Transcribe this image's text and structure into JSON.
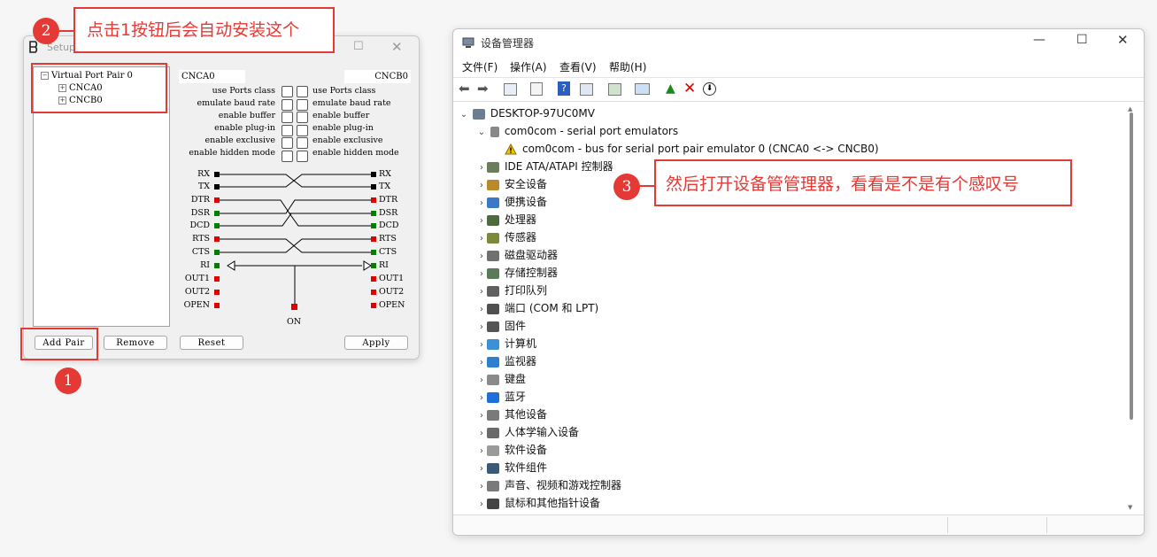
{
  "setup": {
    "title": "Setup for com0com",
    "tree": {
      "root": "Virtual Port Pair 0",
      "children": [
        "CNCA0",
        "CNCB0"
      ]
    },
    "left_port": "CNCA0",
    "right_port": "CNCB0",
    "options": [
      "use Ports class",
      "emulate baud rate",
      "enable buffer",
      "enable plug-in",
      "enable exclusive",
      "enable hidden mode"
    ],
    "left_signals": [
      "RX",
      "TX",
      "DTR",
      "DSR",
      "DCD",
      "RTS",
      "CTS",
      "RI",
      "OUT1",
      "OUT2",
      "OPEN"
    ],
    "right_signals": [
      "RX",
      "TX",
      "DTR",
      "DSR",
      "DCD",
      "RTS",
      "CTS",
      "RI",
      "OUT1",
      "OUT2",
      "OPEN"
    ],
    "on_label": "ON",
    "buttons": {
      "add_pair": "Add Pair",
      "remove": "Remove",
      "reset": "Reset",
      "apply": "Apply"
    },
    "colors": {
      "black": "#000000",
      "red": "#e00000",
      "green": "#008000"
    }
  },
  "annotations": {
    "badge1": "1",
    "badge2": "2",
    "badge3": "3",
    "text2": "点击1按钮后会自动安装这个",
    "text3": "然后打开设备管管理器，看看是不是有个感叹号",
    "color": "#e53935"
  },
  "devmgr": {
    "title": "设备管理器",
    "menu": [
      "文件(F)",
      "操作(A)",
      "查看(V)",
      "帮助(H)"
    ],
    "root": "DESKTOP-97UC0MV",
    "com0com": "com0com - serial port emulators",
    "com0com_child": "com0com - bus for serial port pair emulator 0 (CNCA0 <-> CNCB0)",
    "categories": [
      "IDE ATA/ATAPI 控制器",
      "安全设备",
      "便携设备",
      "处理器",
      "传感器",
      "磁盘驱动器",
      "存储控制器",
      "打印队列",
      "端口 (COM 和 LPT)",
      "固件",
      "计算机",
      "监视器",
      "键盘",
      "蓝牙",
      "其他设备",
      "人体学输入设备",
      "软件设备",
      "软件组件",
      "声音、视频和游戏控制器",
      "鼠标和其他指针设备"
    ]
  }
}
